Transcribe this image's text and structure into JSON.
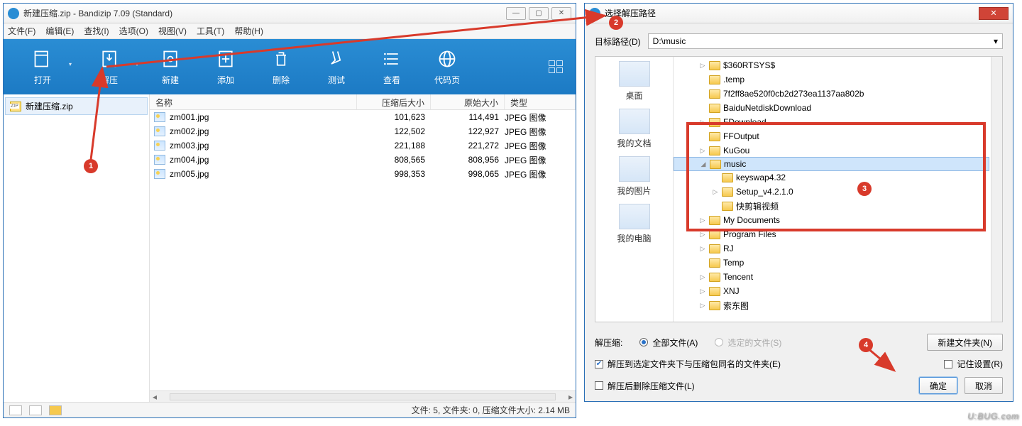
{
  "main_window": {
    "title": "新建压缩.zip - Bandizip 7.09 (Standard)",
    "menus": [
      "文件(F)",
      "编辑(E)",
      "查找(I)",
      "选项(O)",
      "视图(V)",
      "工具(T)",
      "帮助(H)"
    ],
    "toolbar": {
      "open": "打开",
      "extract": "解压",
      "new": "新建",
      "add": "添加",
      "delete": "删除",
      "test": "测试",
      "view": "查看",
      "codepage": "代码页"
    },
    "tree_root": "新建压缩.zip",
    "columns": {
      "name": "名称",
      "compressed": "压缩后大小",
      "original": "原始大小",
      "type": "类型"
    },
    "files": [
      {
        "name": "zm001.jpg",
        "compressed": "101,623",
        "original": "114,491",
        "type": "JPEG 图像"
      },
      {
        "name": "zm002.jpg",
        "compressed": "122,502",
        "original": "122,927",
        "type": "JPEG 图像"
      },
      {
        "name": "zm003.jpg",
        "compressed": "221,188",
        "original": "221,272",
        "type": "JPEG 图像"
      },
      {
        "name": "zm004.jpg",
        "compressed": "808,565",
        "original": "808,956",
        "type": "JPEG 图像"
      },
      {
        "name": "zm005.jpg",
        "compressed": "998,353",
        "original": "998,065",
        "type": "JPEG 图像"
      }
    ],
    "status": "文件: 5, 文件夹: 0, 压缩文件大小: 2.14 MB"
  },
  "dialog": {
    "title": "选择解压路径",
    "path_label": "目标路径(D)",
    "path_value": "D:\\music",
    "places": {
      "desktop": "桌面",
      "docs": "我的文档",
      "pics": "我的图片",
      "pc": "我的电脑"
    },
    "tree": [
      {
        "label": "$360RTSYS$",
        "indent": 1,
        "exp": "▷"
      },
      {
        "label": ".temp",
        "indent": 1,
        "exp": ""
      },
      {
        "label": "7f2ff8ae520f0cb2d273ea1137aa802b",
        "indent": 1,
        "exp": ""
      },
      {
        "label": "BaiduNetdiskDownload",
        "indent": 1,
        "exp": ""
      },
      {
        "label": "FDownload",
        "indent": 1,
        "exp": "▷"
      },
      {
        "label": "FFOutput",
        "indent": 1,
        "exp": ""
      },
      {
        "label": "KuGou",
        "indent": 1,
        "exp": "▷"
      },
      {
        "label": "music",
        "indent": 1,
        "exp": "◢",
        "sel": true
      },
      {
        "label": "keyswap4.32",
        "indent": 2,
        "exp": ""
      },
      {
        "label": "Setup_v4.2.1.0",
        "indent": 2,
        "exp": "▷"
      },
      {
        "label": "快剪辑视频",
        "indent": 2,
        "exp": ""
      },
      {
        "label": "My Documents",
        "indent": 1,
        "exp": "▷"
      },
      {
        "label": "Program Files",
        "indent": 1,
        "exp": "▷"
      },
      {
        "label": "RJ",
        "indent": 1,
        "exp": "▷"
      },
      {
        "label": "Temp",
        "indent": 1,
        "exp": ""
      },
      {
        "label": "Tencent",
        "indent": 1,
        "exp": "▷"
      },
      {
        "label": "XNJ",
        "indent": 1,
        "exp": "▷"
      },
      {
        "label": "索东图",
        "indent": 1,
        "exp": "▷"
      }
    ],
    "opts": {
      "extract_label": "解压缩:",
      "all_files": "全部文件(A)",
      "selected_files": "选定的文件(S)",
      "new_folder": "新建文件夹(N)",
      "same_name": "解压到选定文件夹下与压缩包同名的文件夹(E)",
      "delete_after": "解压后删除压缩文件(L)",
      "remember": "记住设置(R)",
      "ok": "确定",
      "cancel": "取消"
    }
  },
  "annotations": {
    "b1": "1",
    "b2": "2",
    "b3": "3",
    "b4": "4"
  },
  "watermark": "U:BUG.com"
}
